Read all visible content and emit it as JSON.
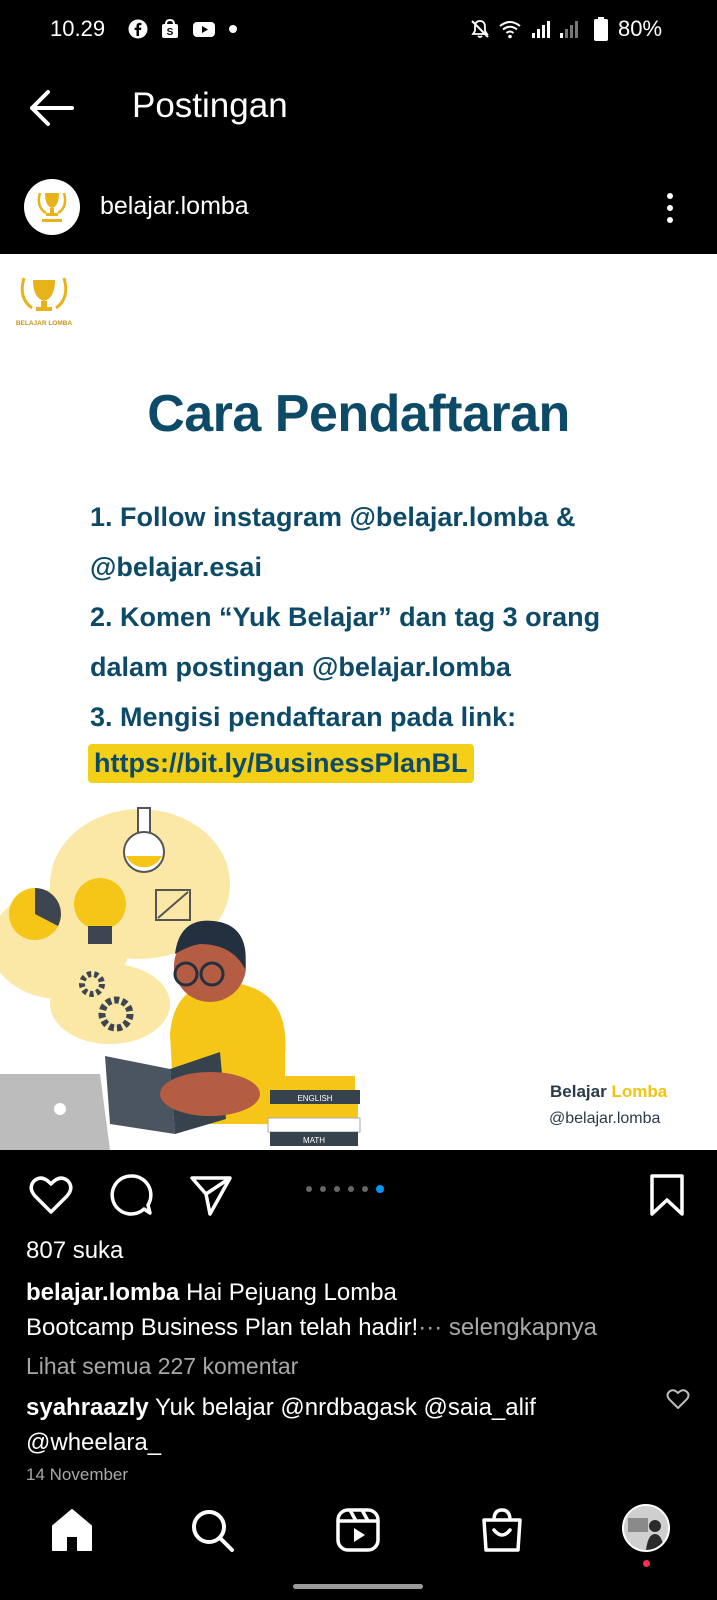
{
  "status_bar": {
    "time": "10.29",
    "battery": "80%",
    "left_icons": [
      "facebook-icon",
      "shopping-bag-icon",
      "youtube-icon",
      "dot-icon"
    ],
    "right_icons": [
      "mute-icon",
      "wifi-icon",
      "signal-icon",
      "signal-icon",
      "battery-icon"
    ]
  },
  "header": {
    "title": "Postingan"
  },
  "post": {
    "username": "belajar.lomba",
    "image": {
      "logo_text": "BELAJAR LOMBA",
      "title": "Cara Pendaftaran",
      "lines": [
        "1. Follow instagram @belajar.lomba &",
        "@belajar.esai",
        "2. Komen “Yuk Belajar” dan tag 3 orang",
        "dalam postingan @belajar.lomba",
        "3. Mengisi pendaftaran pada link:"
      ],
      "link": "https://bit.ly/BusinessPlanBL",
      "brand_part1": "Belajar",
      "brand_part2": "Lomba",
      "brand_handle": "@belajar.lomba",
      "book_labels": [
        "ENGLISH",
        "MATH"
      ]
    },
    "carousel": {
      "count": 6,
      "active": 6
    },
    "likes": "807 suka",
    "caption_user": "belajar.lomba",
    "caption_line1": "Hai Pejuang Lomba",
    "caption_line2": "Bootcamp Business Plan telah hadir!",
    "caption_more_dots": "···",
    "caption_more": "selengkapnya",
    "view_comments": "Lihat semua 227 komentar",
    "comment_user": "syahraazly",
    "comment_text": "Yuk belajar @nrdbagask @saia_alif @wheelara_",
    "date": "14 November"
  },
  "colors": {
    "accent_navy": "#0d4a68",
    "accent_yellow": "#f4cf18",
    "notification_dot": "#ff2d55"
  },
  "bottom_nav": [
    "home-icon",
    "search-icon",
    "reels-icon",
    "shop-icon",
    "profile-avatar"
  ]
}
